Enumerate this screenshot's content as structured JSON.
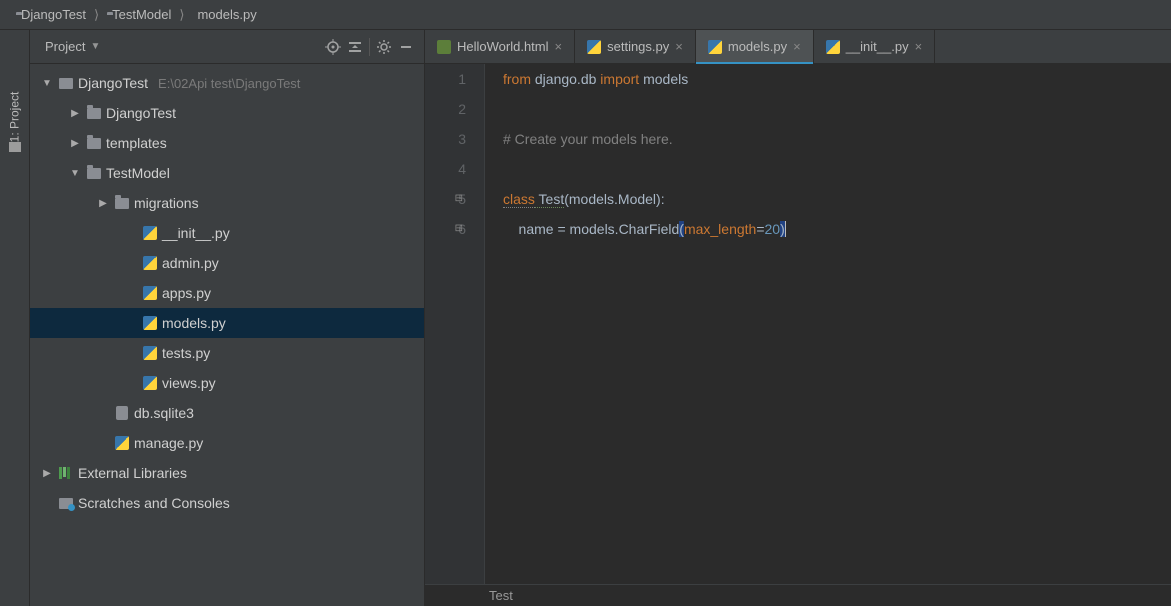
{
  "breadcrumb": [
    {
      "icon": "folder",
      "label": "DjangoTest"
    },
    {
      "icon": "folder",
      "label": "TestModel"
    },
    {
      "icon": "py",
      "label": "models.py"
    }
  ],
  "gutter_left": {
    "label": "1: Project"
  },
  "sidebar": {
    "title": "Project",
    "toolbar_icons": [
      "target",
      "collapse",
      "divider",
      "gear",
      "minimize"
    ]
  },
  "tree": [
    {
      "depth": 0,
      "arrow": "down",
      "icon": "open",
      "label": "DjangoTest",
      "path": "E:\\02Api test\\DjangoTest",
      "selected": false
    },
    {
      "depth": 1,
      "arrow": "right",
      "icon": "folder",
      "label": "DjangoTest"
    },
    {
      "depth": 1,
      "arrow": "right",
      "icon": "folder",
      "label": "templates"
    },
    {
      "depth": 1,
      "arrow": "down",
      "icon": "folder",
      "label": "TestModel"
    },
    {
      "depth": 2,
      "arrow": "right",
      "icon": "folder",
      "label": "migrations"
    },
    {
      "depth": 3,
      "arrow": "",
      "icon": "py",
      "label": "__init__.py"
    },
    {
      "depth": 3,
      "arrow": "",
      "icon": "py",
      "label": "admin.py"
    },
    {
      "depth": 3,
      "arrow": "",
      "icon": "py",
      "label": "apps.py"
    },
    {
      "depth": 3,
      "arrow": "",
      "icon": "py",
      "label": "models.py",
      "selected": true
    },
    {
      "depth": 3,
      "arrow": "",
      "icon": "py",
      "label": "tests.py"
    },
    {
      "depth": 3,
      "arrow": "",
      "icon": "py",
      "label": "views.py"
    },
    {
      "depth": 2,
      "arrow": "",
      "icon": "db",
      "label": "db.sqlite3"
    },
    {
      "depth": 2,
      "arrow": "",
      "icon": "py",
      "label": "manage.py"
    },
    {
      "depth": 0,
      "arrow": "right",
      "icon": "lib",
      "label": "External Libraries"
    },
    {
      "depth": 0,
      "arrow": "",
      "icon": "scratch",
      "label": "Scratches and Consoles"
    }
  ],
  "tabs": [
    {
      "icon": "html",
      "label": "HelloWorld.html",
      "active": false,
      "closable": true
    },
    {
      "icon": "py",
      "label": "settings.py",
      "active": false,
      "closable": true
    },
    {
      "icon": "py",
      "label": "models.py",
      "active": true,
      "closable": true
    },
    {
      "icon": "py",
      "label": "__init__.py",
      "active": false,
      "closable": true
    }
  ],
  "code": {
    "line1": {
      "from": "from",
      "mod": " django.db ",
      "import": "import",
      "models": " models"
    },
    "line3": "# Create your models here.",
    "line5": {
      "class": "class",
      "name": " Test",
      "args": "(models.Model):"
    },
    "line6": {
      "indent": "    name ",
      "eq": "=",
      "call": " models.CharField",
      "open": "(",
      "arg": "max_length",
      "eq2": "=",
      "num": "20",
      "close": ")"
    }
  },
  "line_numbers": [
    "1",
    "2",
    "3",
    "4",
    "5",
    "6"
  ],
  "status": "Test"
}
